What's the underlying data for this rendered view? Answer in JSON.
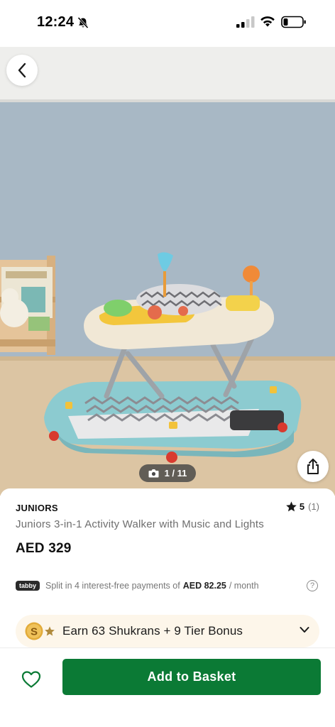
{
  "status_bar": {
    "time": "12:24",
    "icons": [
      "bell-muted-icon",
      "signal-icon",
      "wifi-icon",
      "battery-icon"
    ]
  },
  "gallery": {
    "current_image": "1 / 11",
    "icons": [
      "back-arrow-icon",
      "camera-icon",
      "share-icon"
    ]
  },
  "product": {
    "brand": "JUNIORS",
    "title": "Juniors 3-in-1 Activity Walker with Music and Lights",
    "price": "AED 329",
    "rating": "5",
    "rating_count": "(1)"
  },
  "tabby": {
    "badge": "tabby",
    "text": "Split in 4 interest-free payments of",
    "amount": "AED 82.25",
    "period": "/ month",
    "help": "?"
  },
  "shukran": {
    "coin_letter": "S",
    "text": "Earn 63 Shukrans + 9 Tier Bonus"
  },
  "actions": {
    "add_to_basket": "Add to Basket"
  },
  "colors": {
    "primary_green": "#0b7a35",
    "shukran_bg": "#fdf6ea",
    "walker_teal": "#8ccbd0"
  }
}
